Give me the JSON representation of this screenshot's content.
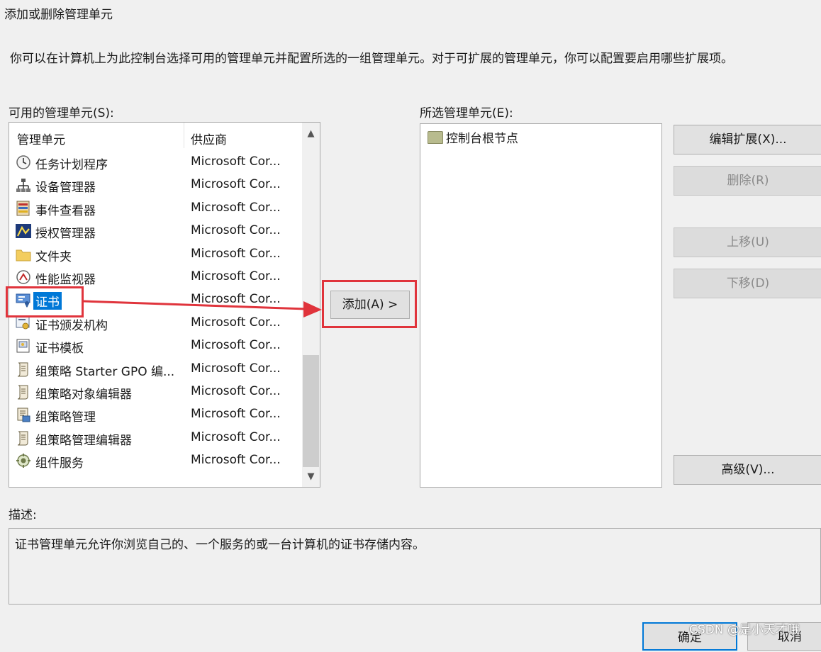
{
  "window": {
    "title": "添加或删除管理单元"
  },
  "intro": "你可以在计算机上为此控制台选择可用的管理单元并配置所选的一组管理单元。对于可扩展的管理单元，你可以配置要启用哪些扩展项。",
  "available": {
    "label": "可用的管理单元(S):",
    "columns": [
      "管理单元",
      "供应商"
    ],
    "items": [
      {
        "name": "任务计划程序",
        "vendor": "Microsoft Cor...",
        "icon": "clock-icon"
      },
      {
        "name": "设备管理器",
        "vendor": "Microsoft Cor...",
        "icon": "device-manager-icon"
      },
      {
        "name": "事件查看器",
        "vendor": "Microsoft Cor...",
        "icon": "event-viewer-icon"
      },
      {
        "name": "授权管理器",
        "vendor": "Microsoft Cor...",
        "icon": "authorization-icon"
      },
      {
        "name": "文件夹",
        "vendor": "Microsoft Cor...",
        "icon": "folder-icon"
      },
      {
        "name": "性能监视器",
        "vendor": "Microsoft Cor...",
        "icon": "performance-icon"
      },
      {
        "name": "证书",
        "vendor": "Microsoft Cor...",
        "icon": "certificate-icon",
        "selected": true
      },
      {
        "name": "证书颁发机构",
        "vendor": "Microsoft Cor...",
        "icon": "certificate-authority-icon"
      },
      {
        "name": "证书模板",
        "vendor": "Microsoft Cor...",
        "icon": "certificate-template-icon"
      },
      {
        "name": "组策略 Starter GPO 编...",
        "vendor": "Microsoft Cor...",
        "icon": "scroll-icon"
      },
      {
        "name": "组策略对象编辑器",
        "vendor": "Microsoft Cor...",
        "icon": "scroll-icon"
      },
      {
        "name": "组策略管理",
        "vendor": "Microsoft Cor...",
        "icon": "gp-management-icon"
      },
      {
        "name": "组策略管理编辑器",
        "vendor": "Microsoft Cor...",
        "icon": "scroll-icon"
      },
      {
        "name": "组件服务",
        "vendor": "Microsoft Cor...",
        "icon": "component-services-icon"
      }
    ]
  },
  "add_button": "添加(A) >",
  "selected": {
    "label": "所选管理单元(E):",
    "root": "控制台根节点"
  },
  "buttons": {
    "edit_ext": "编辑扩展(X)...",
    "remove": "删除(R)",
    "move_up": "上移(U)",
    "move_down": "下移(D)",
    "advanced": "高级(V)..."
  },
  "description": {
    "label": "描述:",
    "text": "证书管理单元允许你浏览自己的、一个服务的或一台计算机的证书存储内容。"
  },
  "footer": {
    "ok": "确定",
    "cancel": "取消"
  },
  "watermark": "CSDN @是小天才哦",
  "colors": {
    "selection": "#0078d7",
    "highlight": "#e0343c"
  }
}
